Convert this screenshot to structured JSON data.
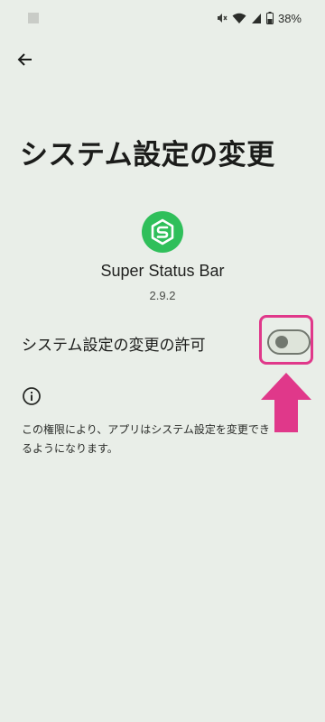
{
  "status_bar": {
    "battery": "38%",
    "icons": [
      "mute-icon",
      "wifi-icon",
      "signal-icon",
      "battery-icon"
    ]
  },
  "header": {
    "back_icon": "arrow-left-icon"
  },
  "page": {
    "title": "システム設定の変更"
  },
  "app": {
    "name": "Super Status Bar",
    "version": "2.9.2",
    "icon": "super-status-bar-logo",
    "icon_color": "#2fbf5a"
  },
  "permission": {
    "label": "システム設定の変更の許可",
    "enabled": false
  },
  "annotation": {
    "highlight_color": "#e0388a"
  },
  "info": {
    "icon": "info-icon",
    "text": "この権限により、アプリはシステム設定を変更できるようになります。"
  }
}
